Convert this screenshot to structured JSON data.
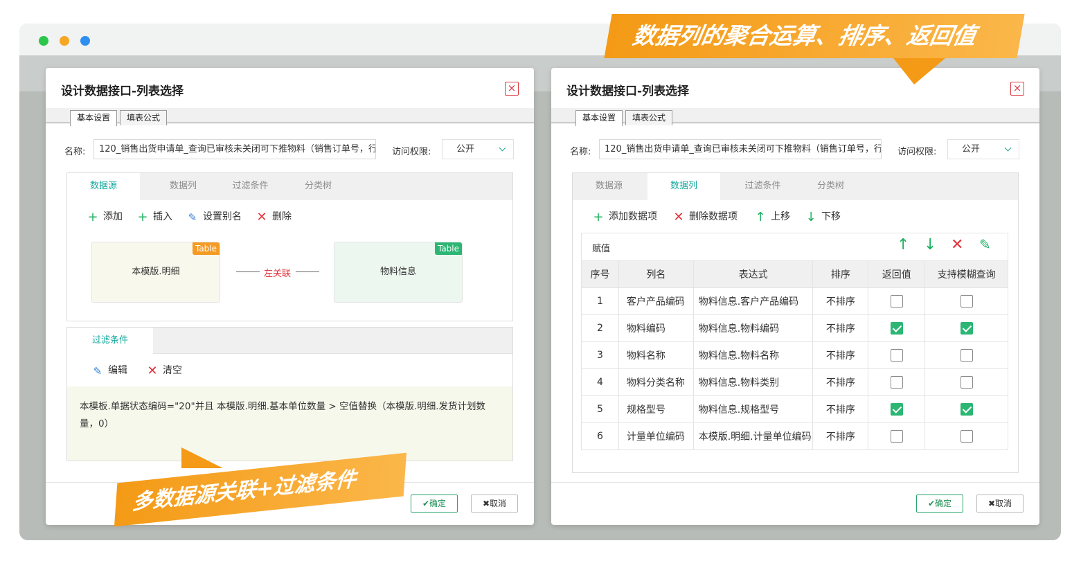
{
  "dialog_left": {
    "title": "设计数据接口-列表选择",
    "tabs": [
      "基本设置",
      "填表公式"
    ],
    "name_label": "名称:",
    "name_value": "120_销售出货申请单_查询已审核未关闭可下推物料（销售订单号，行",
    "access_label": "访问权限:",
    "access_value": "公开",
    "panel_tabs": [
      "数据源",
      "数据列",
      "过滤条件",
      "分类树"
    ],
    "toolbar": {
      "add": "添加",
      "insert": "插入",
      "alias": "设置别名",
      "delete": "删除"
    },
    "nodes": [
      {
        "label": "本模版.明细",
        "badge": "Table",
        "badge_color": "#f59a23",
        "bg": "#f8f9ec"
      },
      {
        "label": "物料信息",
        "badge": "Table",
        "badge_color": "#2bb673",
        "bg": "#ecf7ef"
      }
    ],
    "join_label": "左关联",
    "filter_tab": "过滤条件",
    "filter_toolbar": {
      "edit": "编辑",
      "clear": "清空"
    },
    "filter_text": "本模板.单据状态编码=\"20\"并且 本模版.明细.基本单位数量 > 空值替换（本模版.明细.发货计划数量，0）",
    "ok_label": "确定",
    "cancel_label": "取消"
  },
  "dialog_right": {
    "title": "设计数据接口-列表选择",
    "tabs": [
      "基本设置",
      "填表公式"
    ],
    "name_label": "名称:",
    "name_value": "120_销售出货申请单_查询已审核未关闭可下推物料（销售订单号，行",
    "access_label": "访问权限:",
    "access_value": "公开",
    "panel_tabs": [
      "数据源",
      "数据列",
      "过滤条件",
      "分类树"
    ],
    "toolbar": {
      "add": "添加数据项",
      "delete": "删除数据项",
      "up": "上移",
      "down": "下移"
    },
    "assign_label": "赋值",
    "columns": [
      "序号",
      "列名",
      "表达式",
      "排序",
      "返回值",
      "支持模糊查询"
    ],
    "rows": [
      {
        "no": "1",
        "name": "客户产品编码",
        "expr": "物料信息.客户产品编码",
        "sort": "不排序",
        "ret": false,
        "fuzzy": false
      },
      {
        "no": "2",
        "name": "物料编码",
        "expr": "物料信息.物料编码",
        "sort": "不排序",
        "ret": true,
        "fuzzy": true
      },
      {
        "no": "3",
        "name": "物料名称",
        "expr": "物料信息.物料名称",
        "sort": "不排序",
        "ret": false,
        "fuzzy": false
      },
      {
        "no": "4",
        "name": "物料分类名称",
        "expr": "物料信息.物料类别",
        "sort": "不排序",
        "ret": false,
        "fuzzy": false
      },
      {
        "no": "5",
        "name": "规格型号",
        "expr": "物料信息.规格型号",
        "sort": "不排序",
        "ret": true,
        "fuzzy": true
      },
      {
        "no": "6",
        "name": "计量单位编码",
        "expr": "本模版.明细.计量单位编码",
        "sort": "不排序",
        "ret": false,
        "fuzzy": false
      }
    ],
    "ok_label": "确定",
    "cancel_label": "取消"
  },
  "banner_top": "数据列的聚合运算、排序、返回值",
  "banner_bottom": "多数据源关联+过滤条件",
  "colors": {
    "accent": "#17a8a0",
    "banner": "#f49a16",
    "check": "#2bb673",
    "danger": "#e2323a"
  }
}
